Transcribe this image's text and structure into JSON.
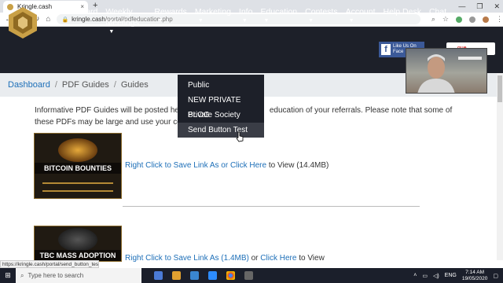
{
  "browser": {
    "tab_title": "Kringle.cash",
    "tab_close": "×",
    "new_tab": "+",
    "window_controls": [
      "—",
      "❐",
      "✕"
    ],
    "url_host": "kringle.cash",
    "url_path": "/portal/pdfeducation.php"
  },
  "nav": {
    "items": [
      {
        "label": "Dashboard",
        "caret": false
      },
      {
        "label": "Weekly Meetings",
        "caret": true
      },
      {
        "label": "Rewards",
        "caret": true
      },
      {
        "label": "Marketing",
        "caret": true
      },
      {
        "label": "Info",
        "caret": true
      },
      {
        "label": "Education",
        "caret": true
      },
      {
        "label": "Contests",
        "caret": true
      },
      {
        "label": "Account",
        "caret": true
      },
      {
        "label": "Help Desk",
        "caret": false
      },
      {
        "label": "Chat",
        "caret": false
      }
    ],
    "like_line1": "Like Us On",
    "like_line2": "Face",
    "red_button_text": "...gue"
  },
  "dropdown": {
    "items": [
      "Public",
      "NEW PRIVATE BLOG",
      "Private Society",
      "Send Button Test"
    ],
    "hover_index": 3
  },
  "breadcrumb": {
    "home": "Dashboard",
    "sep": "/",
    "mid": "PDF Guides",
    "current": "Guides"
  },
  "intro": {
    "part1": "Informative PDF Guides will be posted here",
    "part2": "education of your referrals. Please note that some of these PDFs may be large and use your cellular dat"
  },
  "guides": [
    {
      "title": "BITCOIN BOUNTIES",
      "link1": "Right Click to Save Link As or Click Here",
      "mid": "",
      "link2": "",
      "suffix": " to View (14.4MB)"
    },
    {
      "title": "TBC MASS ADOPTION",
      "link1": "Right Click to Save Link As (1.4MB)",
      "mid": " or ",
      "link2": "Click Here",
      "suffix": " to View"
    }
  ],
  "status_url": "https://kringle.cash/portal/send_button_test.php",
  "taskbar": {
    "search_placeholder": "Type here to search",
    "lang": "ENG",
    "time": "7:14 AM",
    "date": "19/05/2020"
  },
  "colors": {
    "nav_bg": "#1d2029",
    "link": "#1d6fb8",
    "accent_gold": "#c9a046"
  }
}
